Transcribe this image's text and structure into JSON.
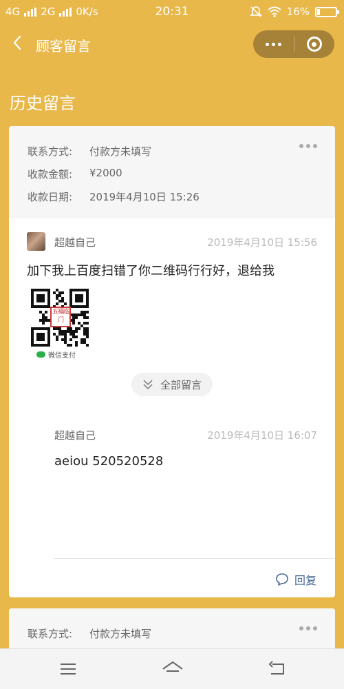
{
  "status_bar": {
    "signal_4g": "4G",
    "signal_2g": "2G",
    "speed": "0K/s",
    "time": "20:31",
    "battery": "16%",
    "battery_level": 0.16,
    "icons": [
      "mute-icon",
      "wifi-icon",
      "battery-icon"
    ]
  },
  "nav": {
    "title": "顾客留言",
    "back_icon": "chevron-left-icon",
    "more_icon": "more-dots-icon",
    "close_icon": "target-close-icon"
  },
  "section_title": "历史留言",
  "cards": [
    {
      "contact_label": "联系方式:",
      "contact_value": "付款方未填写",
      "amount_label": "收款金额:",
      "amount_value": "¥2000",
      "date_label": "收款日期:",
      "date_value": "2019年4月10日 15:26",
      "messages": [
        {
          "user": "超越自己",
          "time": "2019年4月10日 15:56",
          "text": "加下我上百度扫错了你二维码行行好，退给我",
          "qr_caption": "微信支付",
          "qr_badge": "五福临门"
        },
        {
          "user": "超越自己",
          "time": "2019年4月10日 16:07",
          "text": "aeiou 520520528"
        }
      ],
      "all_messages_label": "全部留言",
      "reply_label": "回复"
    },
    {
      "contact_label": "联系方式:",
      "contact_value": "付款方未填写"
    }
  ],
  "colors": {
    "background": "#E8B84A",
    "reply": "#4A6A96",
    "wechat_green": "#2AAE4A"
  }
}
